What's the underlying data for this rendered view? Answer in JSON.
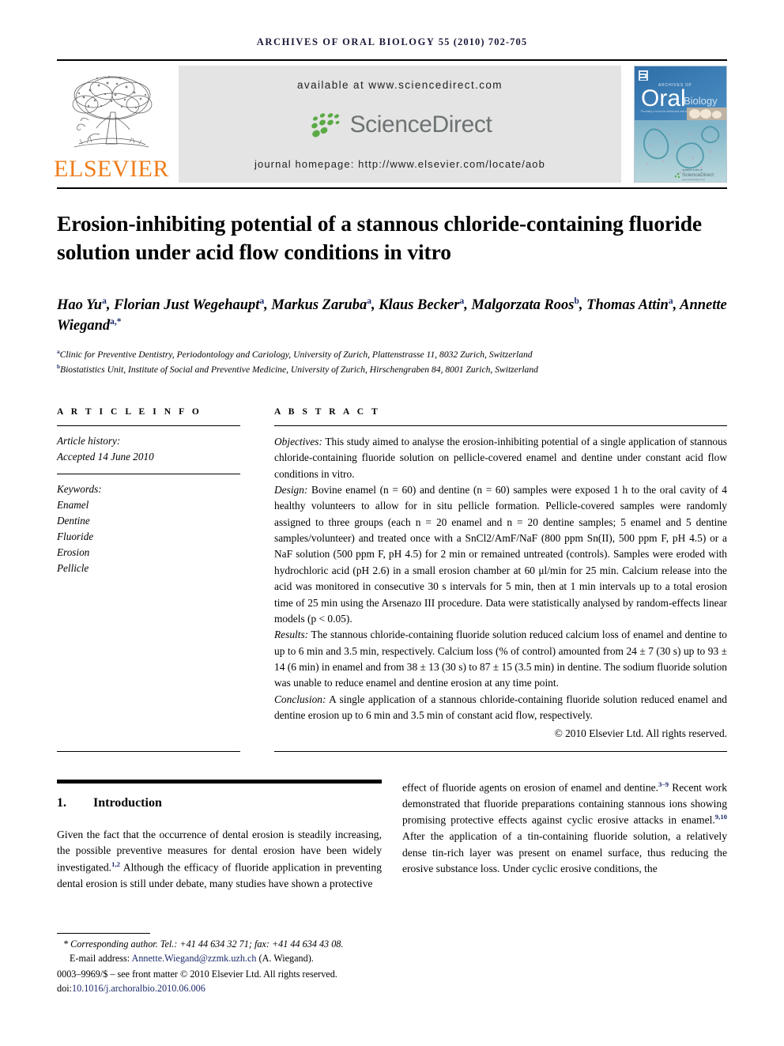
{
  "running_head": {
    "journal": "ARCHIVES OF ORAL BIOLOGY",
    "citation": "55 (2010) 702-705"
  },
  "masthead": {
    "publisher_name": "ELSEVIER",
    "available_at": "available at www.sciencedirect.com",
    "sciencedirect_label": "ScienceDirect",
    "journal_homepage": "journal homepage: http://www.elsevier.com/locate/aob",
    "cover": {
      "kicker": "ARCHIVES OF",
      "title_main": "Oral",
      "title_sub": "Biology",
      "strapline": "Providing a forum for dental and oral craniofacial sciences",
      "footer_brand": "ScienceDirect",
      "footer_url": "www.sciencedirect.com"
    },
    "colors": {
      "elsevier_orange": "#ef7d1a",
      "sciencedirect_green": "#5aaa46",
      "sciencedirect_gray": "#6d7273",
      "masthead_gray": "#e4e4e4",
      "cover_blue": "#2f6fae"
    }
  },
  "article": {
    "title": "Erosion-inhibiting potential of a stannous chloride-containing fluoride solution under acid flow conditions in vitro",
    "authors_html": "Hao Yu<sup>a</sup>, Florian Just Wegehaupt<sup>a</sup>, Markus Zaruba<sup>a</sup>, Klaus Becker<sup>a</sup>, Malgorzata Roos<sup>b</sup>, Thomas Attin<sup>a</sup>, Annette Wiegand<sup>a,*</sup>",
    "affiliations": [
      "Clinic for Preventive Dentistry, Periodontology and Cariology, University of Zurich, Plattenstrasse 11, 8032 Zurich, Switzerland",
      "Biostatistics Unit, Institute of Social and Preventive Medicine, University of Zurich, Hirschengraben 84, 8001 Zurich, Switzerland"
    ],
    "affiliation_marks": [
      "a",
      "b"
    ]
  },
  "article_info": {
    "heading": "A R T I C L E   I N F O",
    "history_label": "Article history:",
    "history_value": "Accepted 14 June 2010",
    "keywords_label": "Keywords:",
    "keywords": [
      "Enamel",
      "Dentine",
      "Fluoride",
      "Erosion",
      "Pellicle"
    ]
  },
  "abstract": {
    "heading": "A B S T R A C T",
    "objectives_label": "Objectives:",
    "objectives_text": " This study aimed to analyse the erosion-inhibiting potential of a single application of stannous chloride-containing fluoride solution on pellicle-covered enamel and dentine under constant acid flow conditions in vitro.",
    "design_label": "Design:",
    "design_text": " Bovine enamel (n = 60) and dentine (n = 60) samples were exposed 1 h to the oral cavity of 4 healthy volunteers to allow for in situ pellicle formation. Pellicle-covered samples were randomly assigned to three groups (each n = 20 enamel and n = 20 dentine samples; 5 enamel and 5 dentine samples/volunteer) and treated once with a SnCl2/AmF/NaF (800 ppm Sn(II), 500 ppm F, pH 4.5) or a NaF solution (500 ppm F, pH 4.5) for 2 min or remained untreated (controls). Samples were eroded with hydrochloric acid (pH 2.6) in a small erosion chamber at 60 μl/min for 25 min. Calcium release into the acid was monitored in consecutive 30 s intervals for 5 min, then at 1 min intervals up to a total erosion time of 25 min using the Arsenazo III procedure. Data were statistically analysed by random-effects linear models (p < 0.05).",
    "results_label": "Results:",
    "results_text": " The stannous chloride-containing fluoride solution reduced calcium loss of enamel and dentine to up to 6 min and 3.5 min, respectively. Calcium loss (% of control) amounted from 24 ± 7 (30 s) up to 93 ± 14 (6 min) in enamel and from 38 ± 13 (30 s) to 87 ± 15 (3.5 min) in dentine. The sodium fluoride solution was unable to reduce enamel and dentine erosion at any time point.",
    "conclusion_label": "Conclusion:",
    "conclusion_text": " A single application of a stannous chloride-containing fluoride solution reduced enamel and dentine erosion up to 6 min and 3.5 min of constant acid flow, respectively.",
    "copyright": "© 2010 Elsevier Ltd. All rights reserved."
  },
  "introduction": {
    "number": "1.",
    "title": "Introduction",
    "left_paragraph_html": "Given the fact that the occurrence of dental erosion is steadily increasing, the possible preventive measures for dental erosion have been widely investigated.<sup class=\"ref\">1,2</sup> Although the efficacy of fluoride application in preventing dental erosion is still under debate, many studies have shown a protective",
    "right_paragraph_html": "effect of fluoride agents on erosion of enamel and dentine.<sup class=\"ref\">3–9</sup> Recent work demonstrated that fluoride preparations containing stannous ions showing promising protective effects against cyclic erosive attacks in enamel.<sup class=\"ref\">9,10</sup> After the application of a tin-containing fluoride solution, a relatively dense tin-rich layer was present on enamel surface, thus reducing the erosive substance loss. Under cyclic erosive conditions, the"
  },
  "footnote": {
    "corresponding_marker": "*",
    "corresponding_text": "Corresponding author. Tel.: +41 44 634 32 71; fax: +41 44 634 43 08.",
    "email_label": "E-mail address:",
    "email_address": "Annette.Wiegand@zzmk.uzh.ch",
    "email_owner": "(A. Wiegand).",
    "issn_line": "0003–9969/$ – see front matter © 2010 Elsevier Ltd. All rights reserved.",
    "doi_label": "doi:",
    "doi_value": "10.1016/j.archoralbio.2010.06.006"
  }
}
